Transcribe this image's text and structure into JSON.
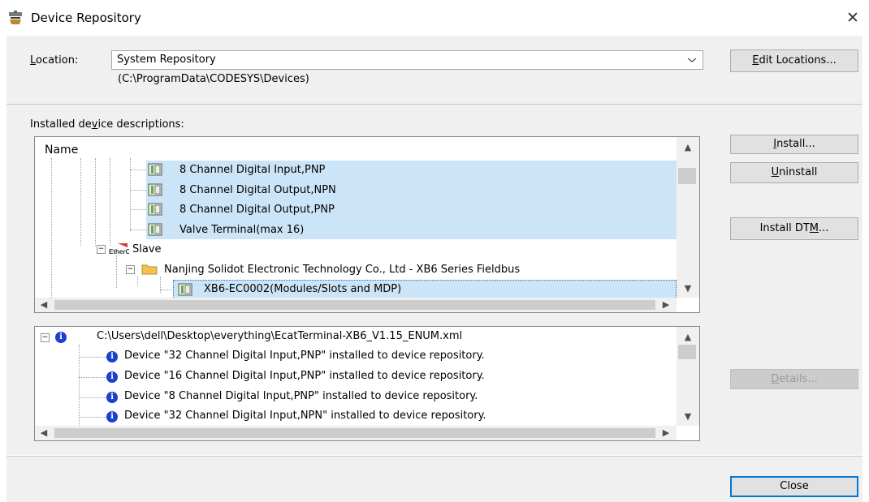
{
  "window": {
    "title": "Device Repository",
    "close_glyph": "✕"
  },
  "location": {
    "label": "Location:",
    "value": "System Repository",
    "path": "(C:\\ProgramData\\CODESYS\\Devices)",
    "edit_button": "Edit Locations..."
  },
  "installed": {
    "label": "Installed device descriptions:",
    "column_header": "Name",
    "items": [
      {
        "label": "8 Channel Digital Input,PNP",
        "icon": "device-module-icon",
        "selected": true
      },
      {
        "label": "8 Channel Digital Output,NPN",
        "icon": "device-module-icon",
        "selected": true
      },
      {
        "label": "8 Channel Digital Output,PNP",
        "icon": "device-module-icon",
        "selected": true
      },
      {
        "label": "Valve Terminal(max 16)",
        "icon": "device-module-icon",
        "selected": true
      },
      {
        "label": "Slave",
        "icon": "ethercat-icon",
        "selected": false,
        "expanded": true
      },
      {
        "label": "Nanjing Solidot Electronic Technology Co., Ltd - XB6 Series Fieldbus",
        "icon": "folder-icon",
        "selected": false,
        "expanded": true
      },
      {
        "label": "XB6-EC0002(Modules/Slots and MDP)",
        "icon": "device-module-icon",
        "selected": true
      }
    ]
  },
  "log": {
    "header": "C:\\Users\\dell\\Desktop\\everything\\EcatTerminal-XB6_V1.15_ENUM.xml",
    "messages": [
      "Device \"32 Channel Digital Input,PNP\" installed to device repository.",
      "Device \"16 Channel Digital Input,PNP\" installed to device repository.",
      "Device \"8 Channel Digital Input,PNP\" installed to device repository.",
      "Device \"32 Channel Digital Input,NPN\" installed to device repository."
    ]
  },
  "buttons": {
    "install": "Install...",
    "uninstall": "Uninstall",
    "install_dtm": "Install DTM...",
    "details": "Details...",
    "close": "Close"
  },
  "colors": {
    "selection": "#cce4f7",
    "accent": "#0078d7",
    "info": "#1a3fd1"
  }
}
